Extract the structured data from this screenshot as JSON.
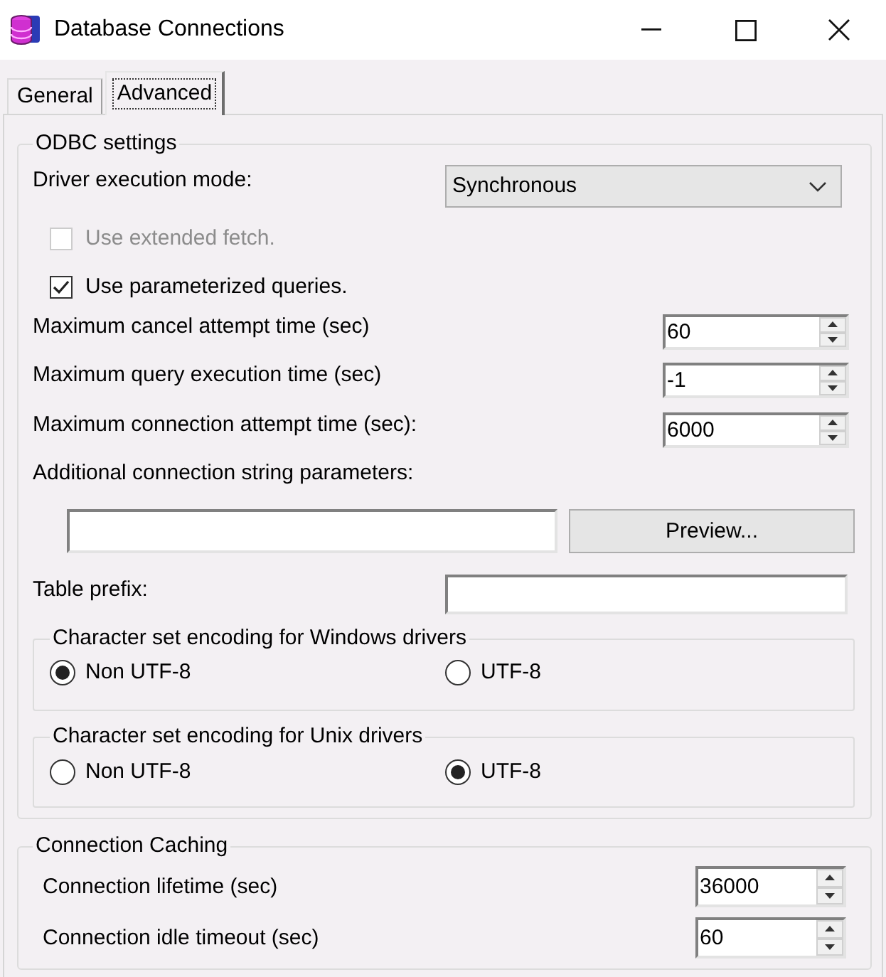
{
  "window": {
    "title": "Database Connections"
  },
  "tabs": [
    {
      "label": "General",
      "selected": false
    },
    {
      "label": "Advanced",
      "selected": true
    }
  ],
  "odbc_settings": {
    "title": "ODBC settings",
    "driver_mode": {
      "label": "Driver execution mode:",
      "value": "Synchronous"
    },
    "checkboxes": [
      {
        "label": "Use extended fetch.",
        "checked": false,
        "disabled": true
      },
      {
        "label": "Use parameterized queries.",
        "checked": true,
        "disabled": false
      }
    ],
    "spin_fields": [
      {
        "label": "Maximum cancel attempt time (sec)",
        "value": "60"
      },
      {
        "label": "Maximum query execution time (sec)",
        "value": "-1"
      },
      {
        "label": "Maximum connection attempt time (sec):",
        "value": "6000"
      }
    ],
    "connection_string": {
      "label": "Additional connection string parameters:",
      "button": "Preview..."
    },
    "table_prefix": {
      "label": "Table prefix:"
    },
    "encoding_groups": [
      {
        "title": "Character set encoding for Windows drivers",
        "options": [
          {
            "label": "Non UTF-8",
            "selected": true
          },
          {
            "label": "UTF-8",
            "selected": false
          }
        ]
      },
      {
        "title": "Character set encoding for Unix drivers",
        "options": [
          {
            "label": "Non UTF-8",
            "selected": false
          },
          {
            "label": "UTF-8",
            "selected": true
          }
        ]
      }
    ]
  },
  "connection_caching": {
    "title": "Connection Caching",
    "spin_fields": [
      {
        "label": "Connection lifetime (sec)",
        "value": "36000"
      },
      {
        "label": "Connection idle timeout (sec)",
        "value": "60"
      }
    ]
  }
}
